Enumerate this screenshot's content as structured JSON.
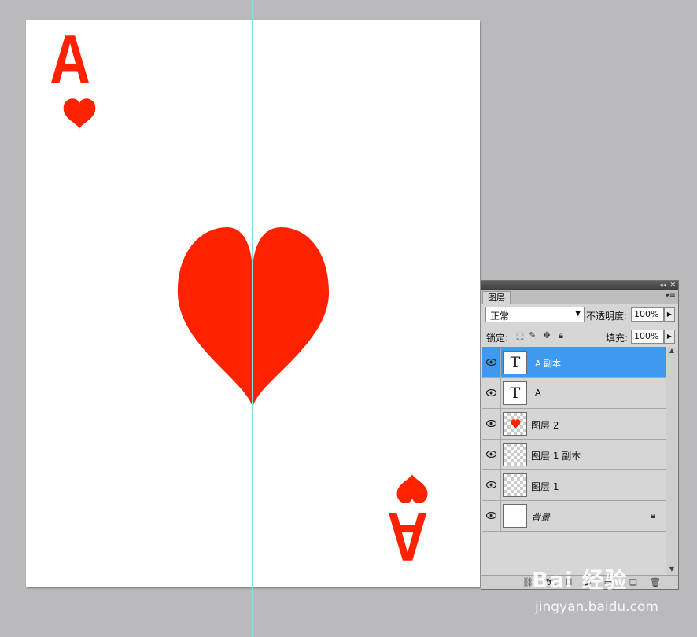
{
  "card": {
    "rank": "A",
    "suit_color": "#ff2200",
    "paper_color": "#ffffff"
  },
  "guides": {
    "color": "#7fe0e8"
  },
  "layers_panel": {
    "tab_label": "图层",
    "blend_mode": "正常",
    "opacity_label": "不透明度:",
    "opacity_value": "100%",
    "lock_label": "锁定:",
    "fill_label": "填充:",
    "fill_value": "100%",
    "selection_color": "#3d9aef",
    "layers": [
      {
        "name": "A 副本",
        "type": "text",
        "thumb_glyph": "T",
        "selected": true
      },
      {
        "name": "A",
        "type": "text",
        "thumb_glyph": "T",
        "selected": false
      },
      {
        "name": "图层 2",
        "type": "pixel",
        "selected": false
      },
      {
        "name": "图层 1 副本",
        "type": "pixel",
        "selected": false
      },
      {
        "name": "图层 1",
        "type": "pixel",
        "selected": false
      },
      {
        "name": "背景",
        "type": "background",
        "locked": true,
        "selected": false
      }
    ],
    "icons": {
      "link": "link-icon",
      "fx_label": "fx.",
      "mask": "mask-icon",
      "adjustment": "adjustment-icon",
      "group": "group-icon",
      "new_layer": "new-layer-icon",
      "trash": "trash-icon"
    }
  },
  "watermark": {
    "logo_text": "Bai 经验",
    "url": "jingyan.baidu.com"
  }
}
